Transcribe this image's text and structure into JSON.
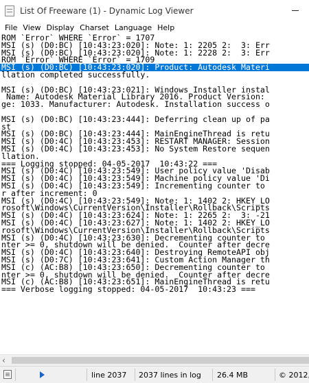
{
  "window": {
    "title": "List Of Freeware (1) - Dynamic Log Viewer"
  },
  "menu": [
    "File",
    "View",
    "Display",
    "Charset",
    "Language",
    "Help"
  ],
  "log": {
    "selected_index": 4,
    "lines": [
      "ROM `Error` WHERE `Error` = 1707",
      "MSI (s) (D0:BC) [10:43:23:020]: Note: 1: 2205 2:  3: Err",
      "MSI (s) (D0:BC) [10:43:23:020]: Note: 1: 2228 2:  3: Err",
      "ROM `Error` WHERE `Error` = 1709",
      "MSI (s) (D0:BC) [10:43:23:020]: Product: Autodesk Materi",
      "llation completed successfully.",
      "",
      "MSI (s) (D0:BC) [10:43:23:021]: Windows Installer instal",
      " Name: Autodesk Material Library 2016. Product Version: ",
      "ge: 1033. Manufacturer: Autodesk. Installation success o",
      "",
      "MSI (s) (D0:BC) [10:43:23:444]: Deferring clean up of pa",
      "st",
      "MSI (s) (D0:BC) [10:43:23:444]: MainEngineThread is retu",
      "MSI (s) (D0:4C) [10:43:23:453]: RESTART MANAGER: Session",
      "MSI (s) (D0:4C) [10:43:23:453]: No System Restore sequen",
      "llation.",
      "=== Logging stopped: 04-05-2017  10:43:22 ===",
      "MSI (s) (D0:4C) [10:43:23:549]: User policy value 'Disab",
      "MSI (s) (D0:4C) [10:43:23:549]: Machine policy value 'Di",
      "MSI (s) (D0:4C) [10:43:23:549]: Incrementing counter to ",
      "r after increment: 0",
      "MSI (s) (D0:4C) [10:43:23:549]: Note: 1: 1402 2: HKEY_LO",
      "rosoft\\Windows\\CurrentVersion\\Installer\\Rollback\\Scripts",
      "MSI (s) (D0:4C) [10:43:23:624]: Note: 1: 2265 2:  3: -21",
      "MSI (s) (D0:4C) [10:43:23:627]: Note: 1: 1402 2: HKEY_LO",
      "rosoft\\Windows\\CurrentVersion\\Installer\\Rollback\\Scripts",
      "MSI (s) (D0:4C) [10:43:23:630]: Decrementing counter to ",
      "nter >= 0, shutdown will be denied.  Counter after decre",
      "MSI (s) (D0:4C) [10:43:23:640]: Destroying RemoteAPI obj",
      "MSI (s) (D0:7C) [10:43:23:641]: Custom Action Manager th",
      "MSI (c) (AC:B8) [10:43:23:650]: Decrementing counter to ",
      "nter >= 0, shutdown will be denied.  Counter after decre",
      "MSI (c) (AC:B8) [10:43:23:651]: MainEngineThread is retu",
      "=== Verbose logging stopped: 04-05-2017  10:43:23 ==="
    ]
  },
  "status": {
    "line": "line 2037",
    "count": "2037 lines in log",
    "size": "26.4 MB",
    "copyright": "© 2012,"
  },
  "colors": {
    "selection": "#0078d7",
    "play_icon": "#1e64c8"
  }
}
